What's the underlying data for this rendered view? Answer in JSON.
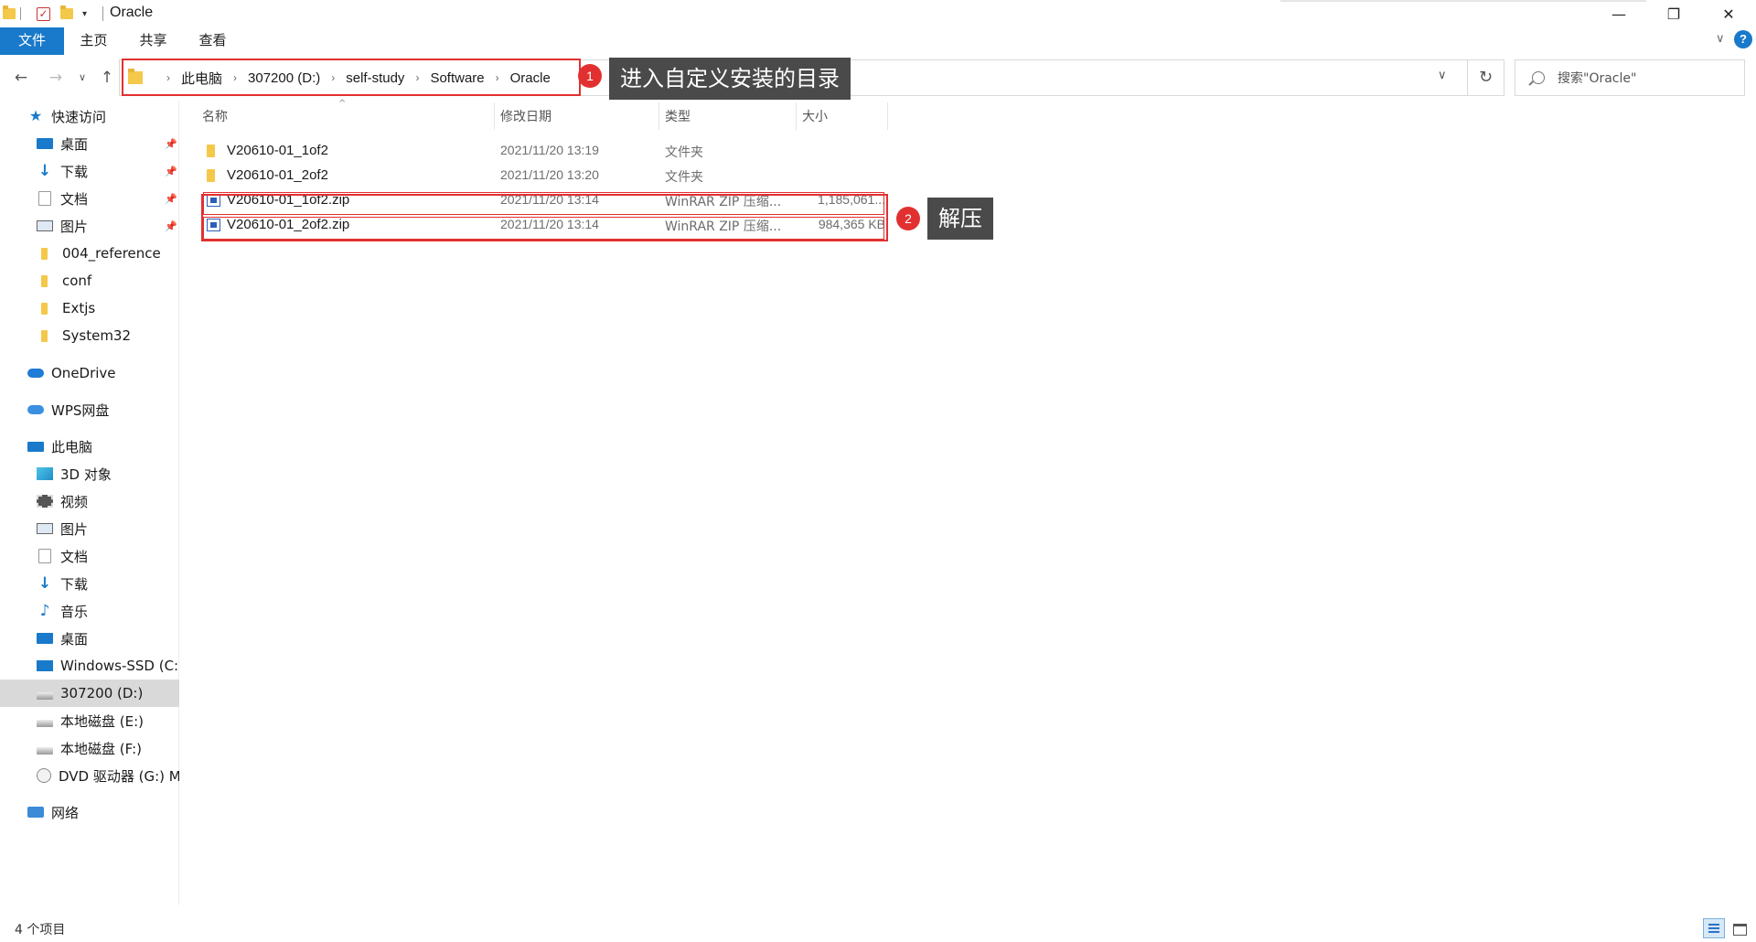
{
  "window": {
    "title": "Oracle",
    "controls": {
      "minimize": "—",
      "maximize": "❐",
      "close": "✕"
    }
  },
  "ribbon": {
    "tabs": [
      "文件",
      "主页",
      "共享",
      "查看"
    ],
    "expand_icon": "chevron-down-icon",
    "help": "?"
  },
  "address": {
    "breadcrumbs": [
      "此电脑",
      "307200 (D:)",
      "self-study",
      "Software",
      "Oracle"
    ],
    "search_placeholder": "搜索\"Oracle\""
  },
  "annotations": [
    {
      "number": "1",
      "text": "进入自定义安装的目录"
    },
    {
      "number": "2",
      "text": "解压"
    }
  ],
  "sidebar": {
    "quick_access": {
      "label": "快速访问",
      "items": [
        {
          "label": "桌面",
          "icon": "desktop-icon",
          "pinned": true
        },
        {
          "label": "下载",
          "icon": "download-icon",
          "pinned": true
        },
        {
          "label": "文档",
          "icon": "document-icon",
          "pinned": true
        },
        {
          "label": "图片",
          "icon": "picture-icon",
          "pinned": true
        },
        {
          "label": "004_reference",
          "icon": "folder-icon",
          "pinned": false
        },
        {
          "label": "conf",
          "icon": "folder-icon",
          "pinned": false
        },
        {
          "label": "Extjs",
          "icon": "folder-icon",
          "pinned": false
        },
        {
          "label": "System32",
          "icon": "folder-icon",
          "pinned": false
        }
      ]
    },
    "onedrive": "OneDrive",
    "wps": "WPS网盘",
    "this_pc": {
      "label": "此电脑",
      "items": [
        {
          "label": "3D 对象",
          "icon": "3d-objects-icon"
        },
        {
          "label": "视频",
          "icon": "video-icon"
        },
        {
          "label": "图片",
          "icon": "picture-icon"
        },
        {
          "label": "文档",
          "icon": "document-icon"
        },
        {
          "label": "下载",
          "icon": "download-icon"
        },
        {
          "label": "音乐",
          "icon": "music-icon"
        },
        {
          "label": "桌面",
          "icon": "desktop-icon"
        },
        {
          "label": "Windows-SSD (C:)",
          "icon": "windows-drive-icon"
        },
        {
          "label": "307200 (D:)",
          "icon": "drive-icon",
          "selected": true
        },
        {
          "label": "本地磁盘 (E:)",
          "icon": "drive-icon"
        },
        {
          "label": "本地磁盘 (F:)",
          "icon": "drive-icon"
        },
        {
          "label": "DVD 驱动器 (G:) M",
          "icon": "dvd-icon"
        }
      ]
    },
    "network": "网络"
  },
  "files": {
    "columns": [
      "名称",
      "修改日期",
      "类型",
      "大小"
    ],
    "rows": [
      {
        "name": "V20610-01_1of2",
        "date": "2021/11/20 13:19",
        "type": "文件夹",
        "size": "",
        "icon": "folder-icon"
      },
      {
        "name": "V20610-01_2of2",
        "date": "2021/11/20 13:20",
        "type": "文件夹",
        "size": "",
        "icon": "folder-icon"
      },
      {
        "name": "V20610-01_1of2.zip",
        "date": "2021/11/20 13:14",
        "type": "WinRAR ZIP 压缩...",
        "size": "1,185,061...",
        "icon": "zip-icon"
      },
      {
        "name": "V20610-01_2of2.zip",
        "date": "2021/11/20 13:14",
        "type": "WinRAR ZIP 压缩...",
        "size": "984,365 KB",
        "icon": "zip-icon"
      }
    ]
  },
  "status": {
    "count": "4 个项目"
  },
  "colors": {
    "accent": "#1979ca",
    "highlight": "#e23030",
    "callout_bg": "#4a4a4a"
  }
}
